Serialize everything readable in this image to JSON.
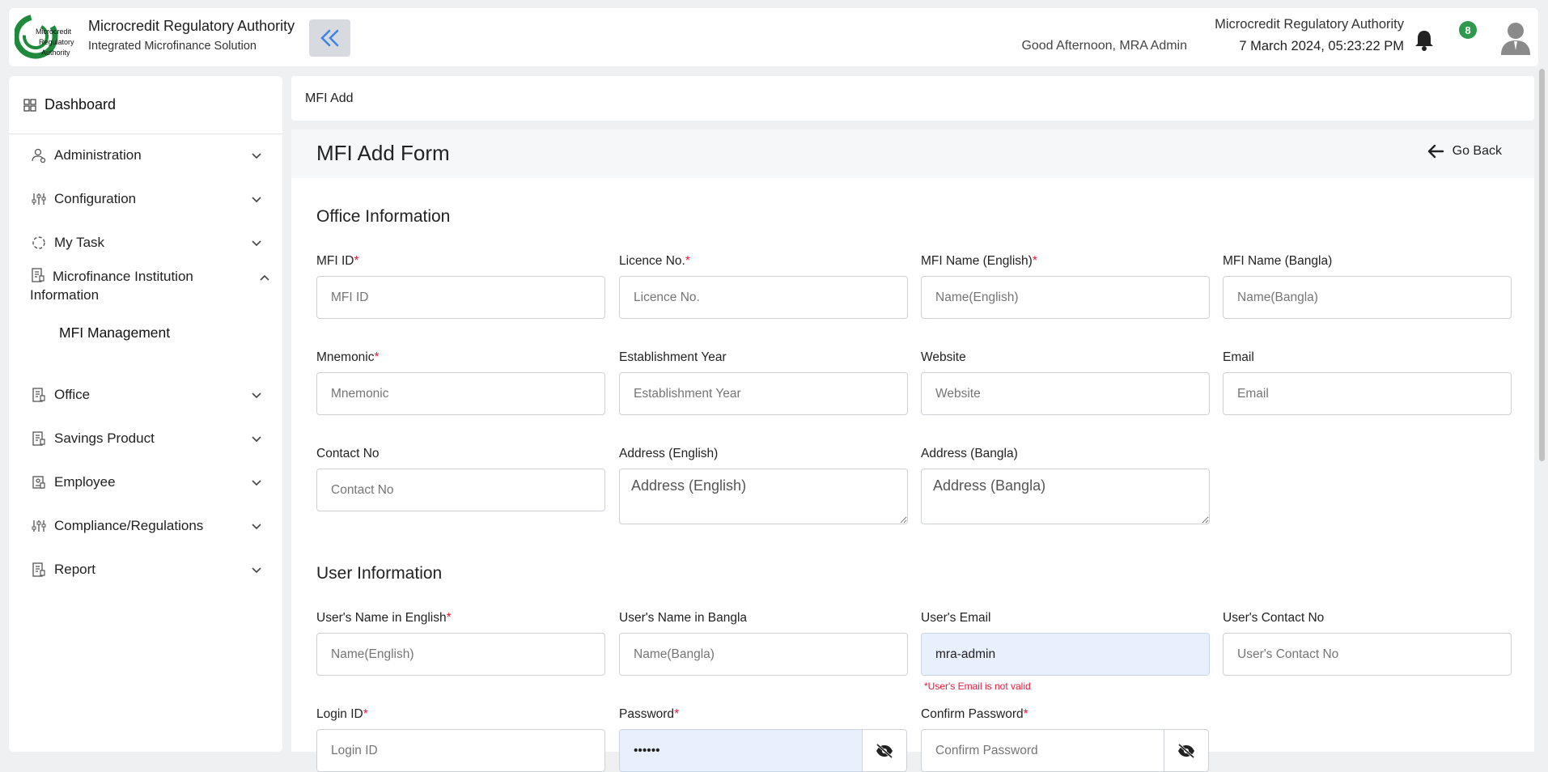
{
  "header": {
    "brand_title": "Microcredit Regulatory Authority",
    "brand_subtitle": "Integrated Microfinance Solution",
    "logo_text": [
      "Microcredit",
      "Regulatory",
      "Authority"
    ],
    "greeting": "Good Afternoon, MRA Admin",
    "org_name": "Microcredit Regulatory Authority",
    "datetime": "7 March 2024, 05:23:22 PM",
    "notification_count": "8"
  },
  "sidebar": {
    "dashboard_label": "Dashboard",
    "items": [
      {
        "label": "Administration",
        "icon": "users-gear-icon"
      },
      {
        "label": "Configuration",
        "icon": "sliders-icon"
      },
      {
        "label": "My Task",
        "icon": "circle-dashed-icon"
      },
      {
        "label": "Microfinance Institution Information",
        "icon": "building-icon"
      },
      {
        "label": "Office",
        "icon": "building-icon"
      },
      {
        "label": "Savings Product",
        "icon": "building-icon"
      },
      {
        "label": "Employee",
        "icon": "id-card-icon"
      },
      {
        "label": "Compliance/Regulations",
        "icon": "sliders-icon"
      },
      {
        "label": "Report",
        "icon": "building-icon"
      }
    ],
    "sub_item": "MFI Management"
  },
  "breadcrumb": "MFI Add",
  "form": {
    "title": "MFI Add Form",
    "go_back": "Go Back",
    "office_section": "Office Information",
    "user_section": "User Information",
    "fields": {
      "mfi_id": {
        "label": "MFI ID",
        "placeholder": "MFI ID",
        "required": "*"
      },
      "licence_no": {
        "label": "Licence No.",
        "placeholder": "Licence No.",
        "required": "*"
      },
      "mfi_name_en": {
        "label": "MFI Name (English)",
        "placeholder": "Name(English)",
        "required": "*"
      },
      "mfi_name_bn": {
        "label": "MFI Name (Bangla)",
        "placeholder": "Name(Bangla)"
      },
      "mnemonic": {
        "label": "Mnemonic",
        "placeholder": "Mnemonic",
        "required": "*"
      },
      "establishment_year": {
        "label": "Establishment Year",
        "placeholder": "Establishment Year"
      },
      "website": {
        "label": "Website",
        "placeholder": "Website"
      },
      "email": {
        "label": "Email",
        "placeholder": "Email"
      },
      "contact_no": {
        "label": "Contact No",
        "placeholder": "Contact No"
      },
      "address_en": {
        "label": "Address (English)",
        "placeholder": "Address (English)"
      },
      "address_bn": {
        "label": "Address (Bangla)",
        "placeholder": "Address (Bangla)"
      },
      "user_name_en": {
        "label": "User's Name in English",
        "placeholder": "Name(English)",
        "required": "*"
      },
      "user_name_bn": {
        "label": "User's Name in Bangla",
        "placeholder": "Name(Bangla)"
      },
      "user_email": {
        "label": "User's Email",
        "value": "mra-admin",
        "error": "*User's Email is not valid"
      },
      "user_contact": {
        "label": "User's Contact No",
        "placeholder": "User's Contact No"
      },
      "login_id": {
        "label": "Login ID",
        "placeholder": "Login ID",
        "required": "*"
      },
      "password": {
        "label": "Password",
        "value": "••••••",
        "required": "*"
      },
      "confirm_password": {
        "label": "Confirm Password",
        "placeholder": "Confirm Password",
        "required": "*"
      }
    }
  },
  "colors": {
    "accent_green": "#2e9a4d",
    "required_red": "#e01b3c",
    "autofill_blue": "#e8f0fe",
    "collapse_button": "#d7dbe0"
  }
}
